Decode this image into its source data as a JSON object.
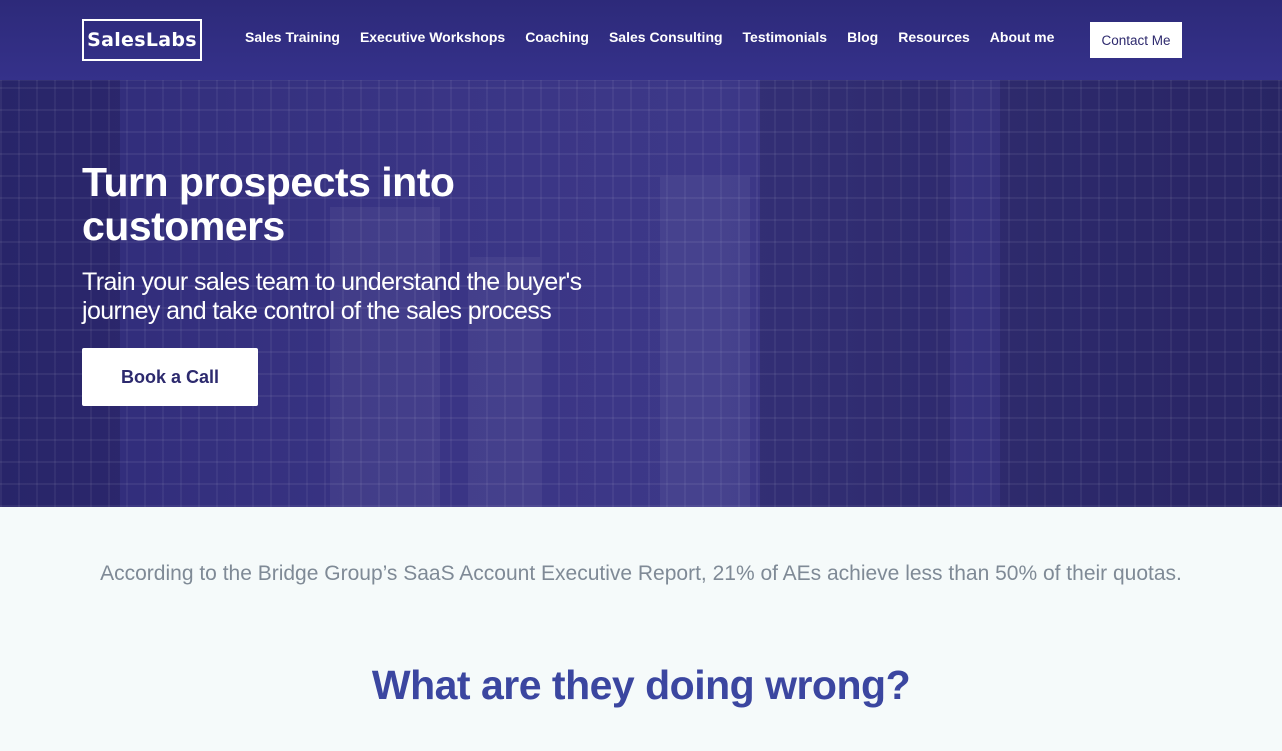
{
  "brand": {
    "logo_text": "SalesLabs"
  },
  "nav": {
    "items": [
      {
        "label": "Sales Training"
      },
      {
        "label": "Executive Workshops"
      },
      {
        "label": "Coaching"
      },
      {
        "label": "Sales Consulting"
      },
      {
        "label": "Testimonials"
      },
      {
        "label": "Blog"
      },
      {
        "label": "Resources"
      },
      {
        "label": "About me"
      }
    ],
    "contact_label": "Contact Me"
  },
  "hero": {
    "title": "Turn prospects into customers",
    "subtitle": "Train your sales team to understand the buyer's journey and take control of the sales process",
    "cta_label": "Book a Call"
  },
  "stats_text": "According to the Bridge Group’s SaaS Account Executive Report, 21% of AEs achieve less than 50% of their quotas.",
  "section_heading": "What are they doing wrong?",
  "colors": {
    "nav_bg": "#2d2a7a",
    "hero_overlay": "#3a3585",
    "heading": "#3b46a0",
    "body_text": "#7f8a96",
    "page_bg": "#f5fafa"
  }
}
